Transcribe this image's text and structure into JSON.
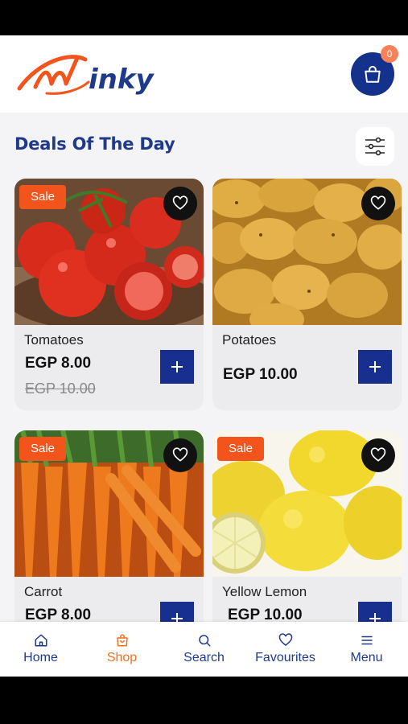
{
  "header": {
    "logo_text": "Winky",
    "cart_count": "0",
    "brand_color": "#14328c",
    "accent_color": "#f2541b"
  },
  "section": {
    "title": "Deals Of The Day"
  },
  "products": [
    {
      "name": "Tomatoes",
      "price": "EGP 8.00",
      "old_price": "EGP 10.00",
      "badge": "Sale",
      "image": "tomatoes"
    },
    {
      "name": "Potatoes",
      "price": "EGP 10.00",
      "image": "potatoes"
    },
    {
      "name": "Carrot",
      "price": "EGP 8.00",
      "badge": "Sale",
      "image": "carrots"
    },
    {
      "name": "Yellow Lemon",
      "price": "EGP 10.00",
      "badge": "Sale",
      "image": "lemons"
    }
  ],
  "nav": {
    "items": [
      {
        "label": "Home",
        "icon": "home-icon"
      },
      {
        "label": "Shop",
        "icon": "shop-bag-icon",
        "active": true
      },
      {
        "label": "Search",
        "icon": "search-icon"
      },
      {
        "label": "Favourites",
        "icon": "heart-icon"
      },
      {
        "label": "Menu",
        "icon": "menu-icon"
      }
    ]
  }
}
